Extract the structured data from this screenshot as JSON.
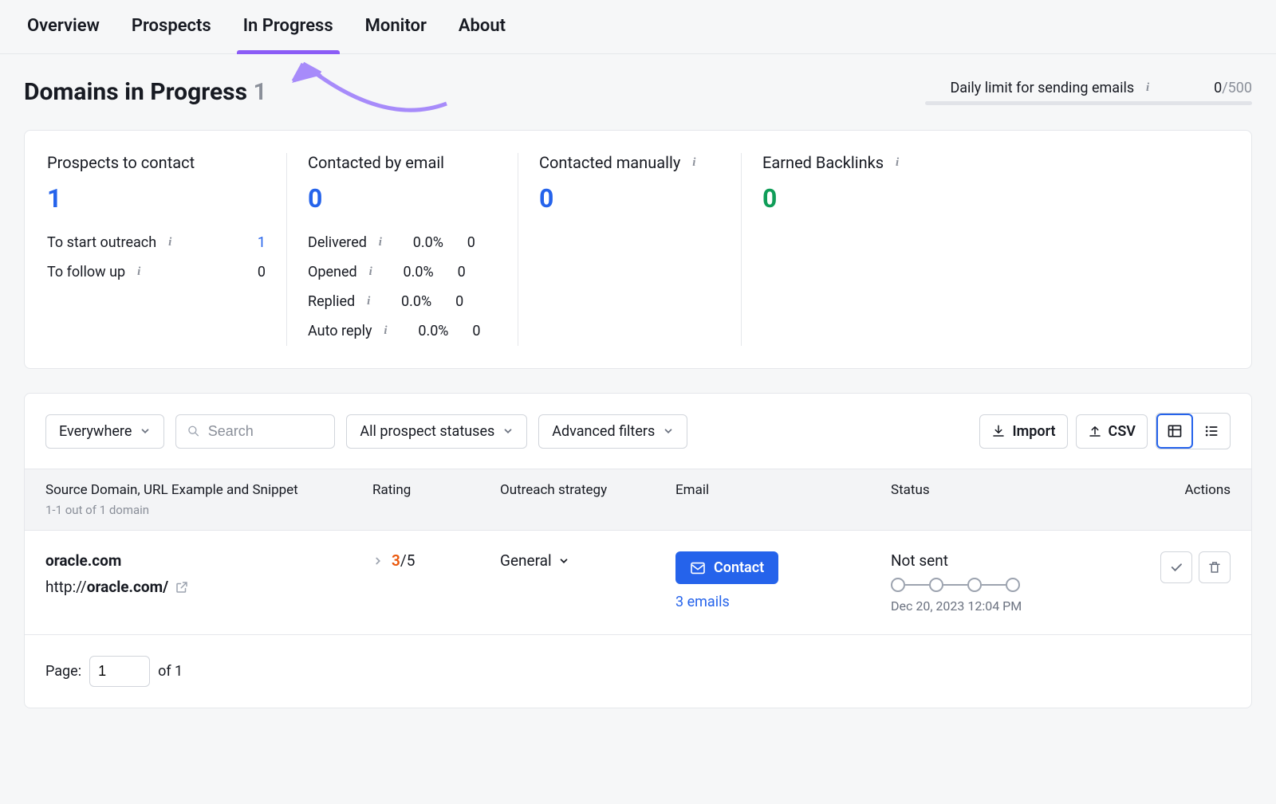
{
  "tabs": {
    "overview": "Overview",
    "prospects": "Prospects",
    "in_progress": "In Progress",
    "monitor": "Monitor",
    "about": "About"
  },
  "page": {
    "title": "Domains in Progress",
    "count": "1"
  },
  "daily_limit": {
    "label": "Daily limit for sending emails",
    "current": "0",
    "max": "/500"
  },
  "stats": {
    "prospects": {
      "title": "Prospects to contact",
      "value": "1",
      "to_start_label": "To start outreach",
      "to_start_value": "1",
      "to_followup_label": "To follow up",
      "to_followup_value": "0"
    },
    "contacted_email": {
      "title": "Contacted by email",
      "value": "0",
      "delivered_label": "Delivered",
      "delivered_pct": "0.0%",
      "delivered_n": "0",
      "opened_label": "Opened",
      "opened_pct": "0.0%",
      "opened_n": "0",
      "replied_label": "Replied",
      "replied_pct": "0.0%",
      "replied_n": "0",
      "autoreply_label": "Auto reply",
      "autoreply_pct": "0.0%",
      "autoreply_n": "0"
    },
    "contacted_manual": {
      "title": "Contacted manually",
      "value": "0"
    },
    "earned": {
      "title": "Earned Backlinks",
      "value": "0"
    }
  },
  "toolbar": {
    "scope": "Everywhere",
    "search_placeholder": "Search",
    "status_filter": "All prospect statuses",
    "advanced": "Advanced filters",
    "import": "Import",
    "csv": "CSV"
  },
  "table": {
    "head_source": "Source Domain, URL Example and Snippet",
    "head_source_sub": "1-1 out of 1 domain",
    "head_rating": "Rating",
    "head_strategy": "Outreach strategy",
    "head_email": "Email",
    "head_status": "Status",
    "head_actions": "Actions"
  },
  "row": {
    "domain": "oracle.com",
    "url_prefix": "http://",
    "url_bold": "oracle.com/",
    "rating_cur": "3",
    "rating_sep": "/",
    "rating_max": "5",
    "strategy": "General",
    "contact_btn": "Contact",
    "emails_link": "3 emails",
    "status": "Not sent",
    "date": "Dec 20, 2023 12:04 PM"
  },
  "pager": {
    "label": "Page:",
    "current": "1",
    "of_label": "of 1"
  }
}
